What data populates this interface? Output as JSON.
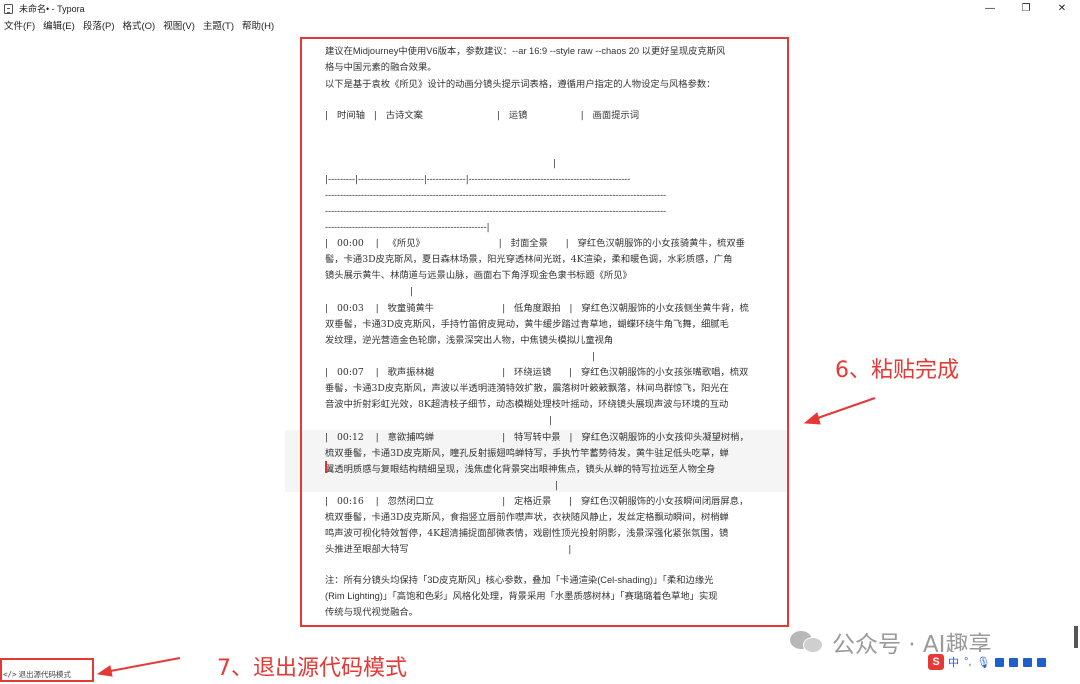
{
  "window": {
    "title": "未命名• - Typora",
    "minimize": "—",
    "maximize": "❐",
    "close": "✕"
  },
  "menu": [
    "文件(F)",
    "编辑(E)",
    "段落(P)",
    "格式(O)",
    "视图(V)",
    "主题(T)",
    "帮助(H)"
  ],
  "editor": {
    "intro1": "建议在Midjourney中使用V6版本，参数建议：--ar 16:9 --style raw --chaos 20 以更好呈现皮克斯风",
    "intro2": "格与中国元素的融合效果。",
    "intro3": "以下是基于袁枚《所见》设计的动画分镜头提示词表格，遵循用户指定的人物设定与风格参数：",
    "header_row": "|   时间轴   |   古诗文案                         |   运镜                  |   画面提示词",
    "pipe1": "|",
    "sep1": "|---------|----------------------|-------------|------------------------------------------------------",
    "sep2": "------------------------------------------------------------------------------------------------------------------",
    "sep3": "------------------------------------------------------------------------------------------------------------------",
    "sep4": "------------------------------------------------------|",
    "r1a": "|   00:00    |   《所见》                         |   封面全景      |   穿红色汉朝服饰的小女孩骑黄牛，梳双垂",
    "r1b": "髻，卡通3D皮克斯风，夏日森林场景，阳光穿透林间光斑，4K渲染，柔和暖色调，水彩质感，广角",
    "r1c": "镜头展示黄牛、林荫道与远景山脉，画面右下角浮现金色隶书标题《所见》",
    "r1d": "|",
    "r2a": "|   00:03    |   牧童骑黄牛                       |   低角度跟拍   |   穿红色汉朝服饰的小女孩侧坐黄牛背，梳",
    "r2b": "双垂髻，卡通3D皮克斯风，手持竹笛俯皮晃动，黄牛缓步踏过青草地，蝴蝶环绕牛角飞舞，细腻毛",
    "r2c": "发纹理，逆光营造金色轮廓，浅景深突出人物，中焦镜头模拟儿童视角",
    "r2d": "|",
    "r3a": "|   00:07    |   歌声振林樾                       |   环绕运镜      |   穿红色汉朝服饰的小女孩张嘴歌唱，梳双",
    "r3b": "垂髻，卡通3D皮克斯风，声波以半透明涟漪特效扩散，震落树叶簌簌飘落，林间鸟群惊飞，阳光在",
    "r3c": "音波中折射彩虹光效，8K超清枝子细节，动态模糊处理枝叶摇动，环绕镜头展现声波与环境的互动",
    "r3d": "|",
    "r4a": "|   00:12    |   意欲捕鸣蝉                       |   特写转中景   |   穿红色汉朝服饰的小女孩仰头凝望树梢，",
    "r4b": "梳双垂髻，卡通3D皮克斯风，瞳孔反射振翅鸣蝉特写，手执竹竿蓄势待发，黄牛驻足低头吃草，蝉",
    "r4c": "翼透明质感与复眼结构精细呈现，浅焦虚化背景突出眼神焦点，镜头从蝉的特写拉远至人物全身",
    "r4d": "|",
    "r5a": "|   00:16    |   忽然闭口立                       |   定格近景      |   穿红色汉朝服饰的小女孩瞬间闭唇屏息，",
    "r5b": "梳双垂髻，卡通3D皮克斯风，食指竖立唇前作噤声状，衣袂随风静止，发丝定格飘动瞬间，树梢蝉",
    "r5c": "鸣声波可视化特效暂停，4K超清捕捉面部微表情，戏剧性顶光投射阴影，浅景深强化紧张氛围，镜",
    "r5d": "头推进至眼部大特写                                                      |",
    "note1": "注：所有分镜头均保持「3D皮克斯风」核心参数，叠加「卡通渲染(Cel-shading)」「柔和边缘光",
    "note2": "(Rim Lighting)」「高饱和色彩」风格化处理，背景采用「水墨质感树林」「赛璐璐着色草地」实现",
    "note3": "传统与现代视觉融合。"
  },
  "annotations": {
    "step6": "6、粘贴完成",
    "step7": "7、退出源代码模式",
    "color": "#e53935"
  },
  "statusbar": {
    "source_mode_label": "退出源代码模式",
    "source_mode_icon": "</>"
  },
  "watermark": {
    "text": "公众号 · AI趣享"
  },
  "ime": {
    "logo": "S",
    "lang": "中",
    "punct": "°,"
  }
}
